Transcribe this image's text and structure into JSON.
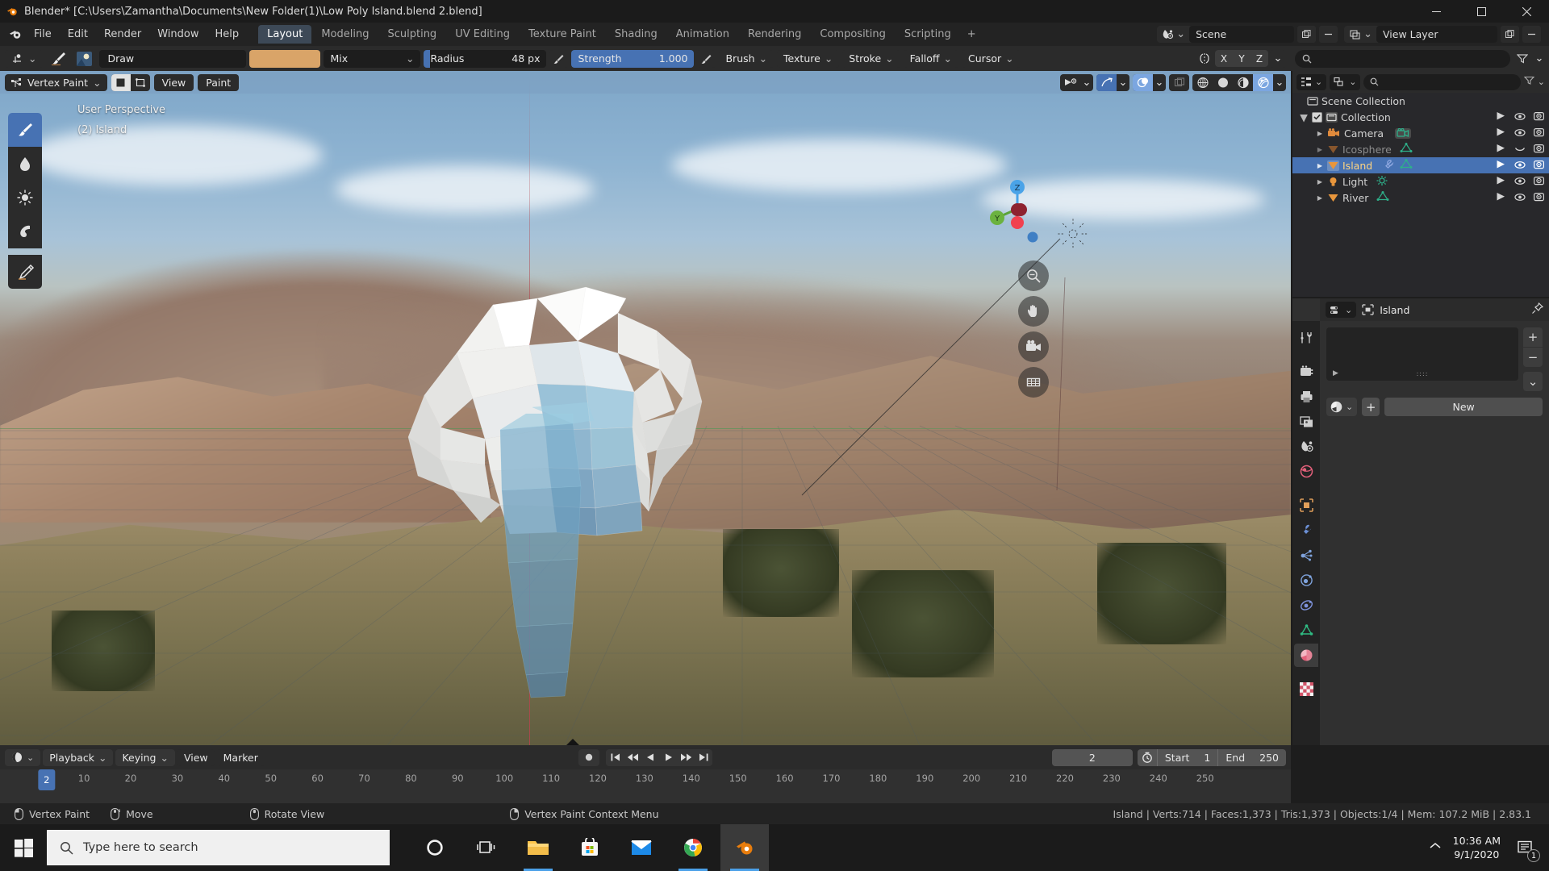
{
  "window": {
    "title": "Blender* [C:\\Users\\Zamantha\\Documents\\New Folder(1)\\Low Poly Island.blend 2.blend]",
    "minimize": "–",
    "maximize": "☐",
    "close": "✕"
  },
  "topbar": {
    "menus": [
      "File",
      "Edit",
      "Render",
      "Window",
      "Help"
    ],
    "workspaces": [
      {
        "label": "Layout",
        "active": true
      },
      {
        "label": "Modeling",
        "active": false
      },
      {
        "label": "Sculpting",
        "active": false
      },
      {
        "label": "UV Editing",
        "active": false
      },
      {
        "label": "Texture Paint",
        "active": false
      },
      {
        "label": "Shading",
        "active": false
      },
      {
        "label": "Animation",
        "active": false
      },
      {
        "label": "Rendering",
        "active": false
      },
      {
        "label": "Compositing",
        "active": false
      },
      {
        "label": "Scripting",
        "active": false
      },
      {
        "label": "+",
        "active": false
      }
    ],
    "scene_name": "Scene",
    "view_layer_name": "View Layer"
  },
  "toolsettings": {
    "brush_name": "Draw",
    "brush_color": "#d9a468",
    "blend_mode": "Mix",
    "radius_label": "Radius",
    "radius_value": "48 px",
    "strength_label": "Strength",
    "strength_value": "1.000",
    "strength_fill_pct": 100,
    "menus": [
      "Brush",
      "Texture",
      "Stroke",
      "Falloff",
      "Cursor"
    ],
    "mirror_axes": [
      "X",
      "Y",
      "Z"
    ],
    "search_placeholder": ""
  },
  "viewport": {
    "mode": "Vertex Paint",
    "menus": [
      "View",
      "Paint"
    ],
    "perspective_label": "User Perspective",
    "object_label": "(2) Island",
    "gizmo_axes": [
      "Z",
      "Y",
      "X"
    ],
    "left_tools": [
      "draw-brush-tool",
      "blur-tool",
      "average-tool",
      "smear-tool",
      "annotate-tool"
    ],
    "shading_modes": [
      "wireframe",
      "solid",
      "material-preview",
      "rendered"
    ],
    "active_shading": "rendered"
  },
  "outliner": {
    "header": {
      "search_placeholder": ""
    },
    "rows": [
      {
        "name": "Scene Collection",
        "indent": 0,
        "icon": "collection-icon",
        "selected": false,
        "hidden": false,
        "has_checkbox": false,
        "has_expand": false,
        "has_eye": false,
        "extras": []
      },
      {
        "name": "Collection",
        "indent": 1,
        "icon": "collection-icon",
        "selected": false,
        "hidden": false,
        "has_checkbox": true,
        "has_expand": true,
        "has_eye": true,
        "extras": []
      },
      {
        "name": "Camera",
        "indent": 2,
        "icon": "camera-object-icon",
        "selected": false,
        "hidden": false,
        "has_checkbox": false,
        "has_expand": true,
        "has_eye": true,
        "extras": [
          "camera-data-icon"
        ]
      },
      {
        "name": "Icosphere",
        "indent": 2,
        "icon": "mesh-object-icon",
        "selected": false,
        "hidden": true,
        "has_checkbox": false,
        "has_expand": true,
        "has_eye": true,
        "extras": [
          "mesh-data-icon"
        ]
      },
      {
        "name": "Island",
        "indent": 2,
        "icon": "mesh-object-icon",
        "selected": true,
        "hidden": false,
        "has_checkbox": false,
        "has_expand": true,
        "has_eye": true,
        "extras": [
          "modifier-icon",
          "mesh-data-icon"
        ]
      },
      {
        "name": "Light",
        "indent": 2,
        "icon": "light-object-icon",
        "selected": false,
        "hidden": false,
        "has_checkbox": false,
        "has_expand": true,
        "has_eye": true,
        "extras": [
          "light-data-icon"
        ]
      },
      {
        "name": "River",
        "indent": 2,
        "icon": "mesh-object-icon",
        "selected": false,
        "hidden": false,
        "has_checkbox": false,
        "has_expand": true,
        "has_eye": true,
        "extras": [
          "mesh-data-icon"
        ]
      }
    ]
  },
  "properties": {
    "breadcrumb_object": "Island",
    "new_button": "New",
    "list_add": "+",
    "list_remove": "−",
    "tabs": [
      {
        "name": "tool",
        "color": "#cfcfcf"
      },
      {
        "name": "render",
        "color": "#cfcfcf"
      },
      {
        "name": "output",
        "color": "#cfcfcf"
      },
      {
        "name": "view-layer",
        "color": "#cfcfcf"
      },
      {
        "name": "scene",
        "color": "#cfcfcf"
      },
      {
        "name": "world",
        "color": "#e2607a"
      },
      {
        "name": "object",
        "color": "#e2a05a"
      },
      {
        "name": "modifiers",
        "color": "#6b8fd4"
      },
      {
        "name": "particles",
        "color": "#7fa3dd"
      },
      {
        "name": "physics",
        "color": "#7fa3dd"
      },
      {
        "name": "constraints",
        "color": "#7f93dd"
      },
      {
        "name": "object-data",
        "color": "#2fba82"
      },
      {
        "name": "material",
        "color": "#e2607a"
      },
      {
        "name": "texture",
        "color": "#d2566a"
      }
    ],
    "active_tab": "material"
  },
  "timeline": {
    "menus": [
      "Playback",
      "Keying",
      "View",
      "Marker"
    ],
    "current_frame": "2",
    "start_label": "Start",
    "start_value": "1",
    "end_label": "End",
    "end_value": "250",
    "ticks": [
      10,
      20,
      30,
      40,
      50,
      60,
      70,
      80,
      90,
      100,
      110,
      120,
      130,
      140,
      150,
      160,
      170,
      180,
      190,
      200,
      210,
      220,
      230,
      240,
      250
    ],
    "playhead_frame": 2,
    "transport_icons": [
      "jump-to-start",
      "prev-keyframe",
      "play-reverse",
      "play",
      "next-keyframe",
      "jump-to-end"
    ]
  },
  "statusbar": {
    "items": [
      {
        "mouse": "left-mouse-icon",
        "label": "Vertex Paint"
      },
      {
        "mouse": "middle-mouse-drag-icon",
        "label": "Move"
      },
      {
        "mouse": "middle-mouse-icon",
        "label": "Rotate View"
      },
      {
        "mouse": "right-mouse-icon",
        "label": "Vertex Paint Context Menu"
      }
    ],
    "scene_stats": "Island | Verts:714 | Faces:1,373 | Tris:1,373 | Objects:1/4 | Mem: 107.2 MiB | 2.83.1"
  },
  "taskbar": {
    "search_placeholder": "Type here to search",
    "apps": [
      {
        "name": "cortana-icon",
        "active": false,
        "running": false
      },
      {
        "name": "task-view-icon",
        "active": false,
        "running": false
      },
      {
        "name": "file-explorer-icon",
        "active": false,
        "running": true
      },
      {
        "name": "microsoft-store-icon",
        "active": false,
        "running": false
      },
      {
        "name": "mail-icon",
        "active": false,
        "running": false
      },
      {
        "name": "chrome-icon",
        "active": false,
        "running": true
      },
      {
        "name": "blender-icon",
        "active": true,
        "running": true
      }
    ],
    "time": "10:36 AM",
    "date": "9/1/2020",
    "notification_count": "1"
  }
}
